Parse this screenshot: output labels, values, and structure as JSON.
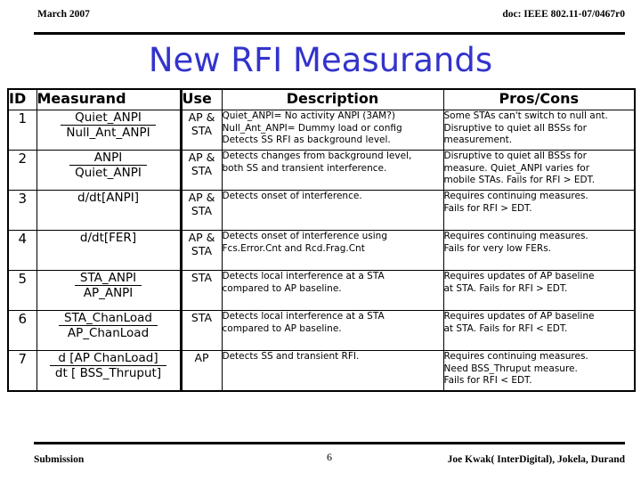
{
  "header": {
    "left": "March 2007",
    "right": "doc: IEEE 802.11-07/0467r0"
  },
  "title": "New RFI Measurands",
  "accent_color": "#3333CC",
  "table": {
    "columns": [
      "ID",
      "Measurand",
      "Use",
      "Description",
      "Pros/Cons"
    ],
    "rows": [
      {
        "id": "1",
        "measurand": {
          "type": "fraction",
          "numerator": "Quiet_ANPI",
          "denominator": "Null_Ant_ANPI"
        },
        "use": [
          "AP &",
          "STA"
        ],
        "description": [
          "Quiet_ANPI= No activity ANPI (3AM?)",
          "Null_Ant_ANPI= Dummy load or config",
          "Detects SS RFI as background level."
        ],
        "pros_cons": [
          "Some STAs can't switch to null ant.",
          "Disruptive to quiet all BSSs for",
          "measurement."
        ]
      },
      {
        "id": "2",
        "measurand": {
          "type": "fraction",
          "numerator": "ANPI",
          "denominator": "Quiet_ANPI"
        },
        "use": [
          "AP &",
          "STA"
        ],
        "description": [
          "Detects changes from background level,",
          "both SS and transient interference."
        ],
        "pros_cons": [
          "Disruptive to quiet all BSSs for",
          "measure. Quiet_ANPI varies for",
          "mobile STAs. Fails for RFI > EDT."
        ]
      },
      {
        "id": "3",
        "measurand": {
          "type": "plain",
          "text": "d/dt[ANPI]"
        },
        "use": [
          "AP &",
          "STA"
        ],
        "description": [
          "Detects onset of interference."
        ],
        "pros_cons": [
          "Requires continuing measures.",
          "Fails for RFI > EDT."
        ]
      },
      {
        "id": "4",
        "measurand": {
          "type": "plain",
          "text": "d/dt[FER]"
        },
        "use": [
          "AP &",
          "STA"
        ],
        "description": [
          "Detects onset of interference using",
          "Fcs.Error.Cnt and Rcd.Frag.Cnt"
        ],
        "pros_cons": [
          "Requires continuing measures.",
          "Fails for very low FERs."
        ]
      },
      {
        "id": "5",
        "measurand": {
          "type": "fraction",
          "numerator": "STA_ANPI",
          "denominator": "AP_ANPI"
        },
        "use": [
          "STA"
        ],
        "description": [
          "Detects local interference at a STA",
          "compared to AP baseline."
        ],
        "pros_cons": [
          "Requires updates of AP baseline",
          "at STA.  Fails for RFI > EDT."
        ]
      },
      {
        "id": "6",
        "measurand": {
          "type": "fraction",
          "numerator": "STA_ChanLoad",
          "denominator": "AP_ChanLoad"
        },
        "use": [
          "STA"
        ],
        "description": [
          "Detects local interference at a STA",
          "compared to AP baseline."
        ],
        "pros_cons": [
          "Requires updates of AP baseline",
          "at STA.  Fails for RFI < EDT."
        ]
      },
      {
        "id": "7",
        "measurand": {
          "type": "fraction",
          "numerator": "d [AP ChanLoad]",
          "denominator": "dt [ BSS_Thruput]"
        },
        "use": [
          "AP"
        ],
        "description": [
          "Detects SS and transient RFI."
        ],
        "pros_cons": [
          "Requires continuing measures.",
          "Need BSS_Thruput measure.",
          "Fails for RFI < EDT."
        ]
      }
    ]
  },
  "footer": {
    "left": "Submission",
    "page": "6",
    "right": "Joe Kwak( InterDigital), Jokela, Durand"
  }
}
